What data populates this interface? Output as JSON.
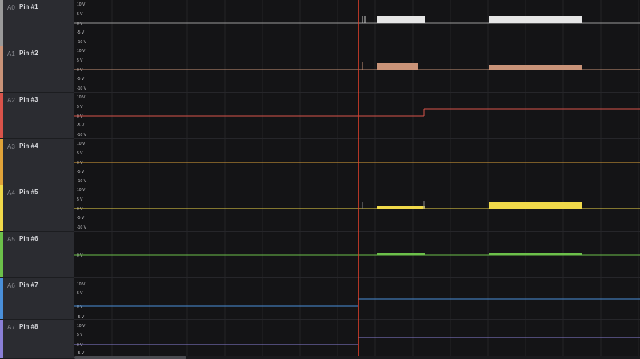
{
  "channels": [
    {
      "index": "A0",
      "name": "Pin #1",
      "color": "#9a9a9a",
      "ticks": [
        "10 V",
        "5 V",
        "0 V",
        "-5 V",
        "-10 V"
      ]
    },
    {
      "index": "A1",
      "name": "Pin #2",
      "color": "#c99378",
      "ticks": [
        "10 V",
        "5 V",
        "0 V",
        "-5 V",
        "-10 V"
      ]
    },
    {
      "index": "A2",
      "name": "Pin #3",
      "color": "#d9534a",
      "ticks": [
        "10 V",
        "5 V",
        "0 V",
        "-5 V",
        "-10 V"
      ]
    },
    {
      "index": "A3",
      "name": "Pin #4",
      "color": "#e0a339",
      "ticks": [
        "10 V",
        "5 V",
        "0 V",
        "-5 V",
        "-10 V"
      ]
    },
    {
      "index": "A4",
      "name": "Pin #5",
      "color": "#f0d94a",
      "ticks": [
        "10 V",
        "5 V",
        "0 V",
        "-5 V",
        "-10 V"
      ]
    },
    {
      "index": "A5",
      "name": "Pin #6",
      "color": "#6cc04a",
      "ticks": [
        "0 V"
      ]
    },
    {
      "index": "A6",
      "name": "Pin #7",
      "color": "#4a8fd9",
      "ticks": [
        "10 V",
        "5 V",
        "0 V",
        "-5 V"
      ]
    },
    {
      "index": "A7",
      "name": "Pin #8",
      "color": "#8a7fd6",
      "ticks": [
        "10 V",
        "5 V",
        "0 V",
        "-5 V"
      ]
    }
  ],
  "colors": {
    "cursor": "#e8412c",
    "sidebar_bg": "#2b2c31",
    "plot_bg": "#141416",
    "grid": "#232327"
  }
}
